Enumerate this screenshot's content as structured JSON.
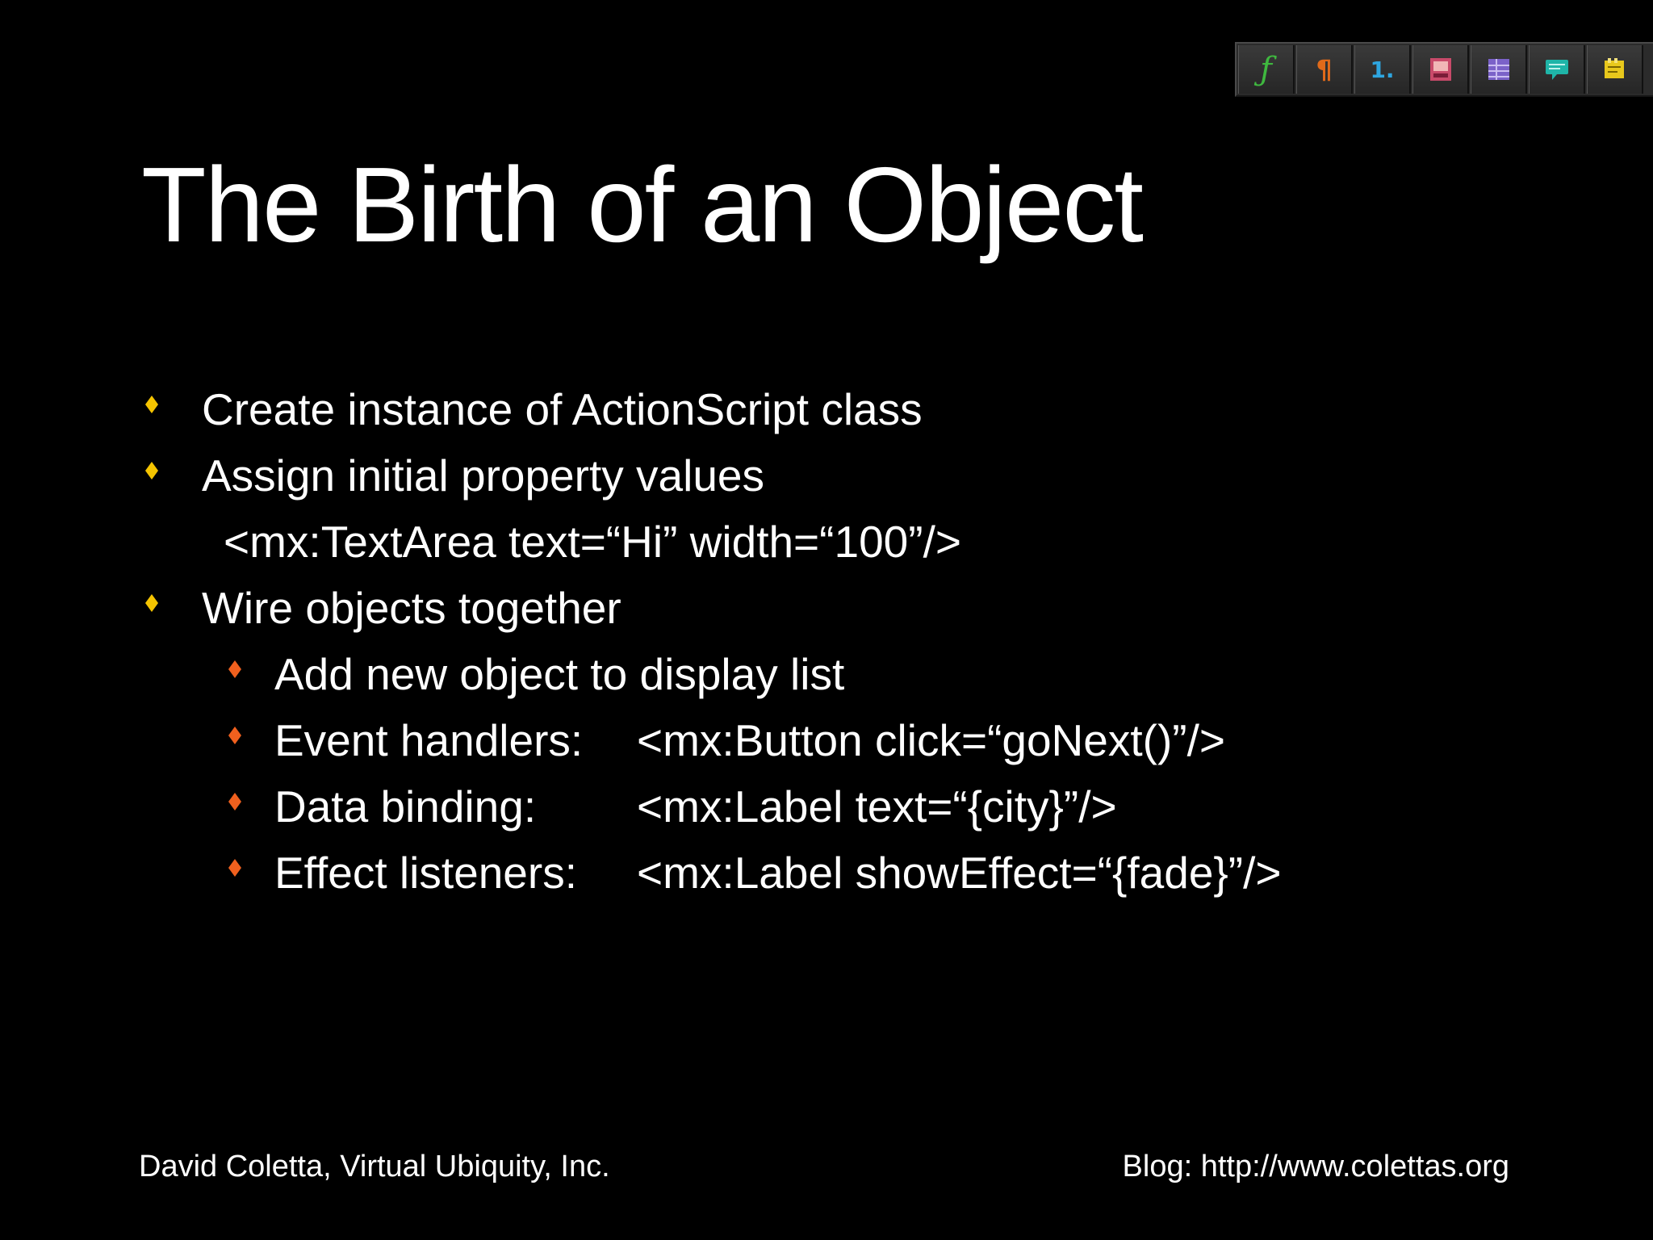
{
  "toolbar": {
    "buttons": [
      {
        "icon": "function-icon",
        "glyph": "ƒ"
      },
      {
        "icon": "paragraph-icon",
        "glyph": "¶"
      },
      {
        "icon": "numbering-icon",
        "glyph": "1."
      },
      {
        "icon": "slide-picture-icon"
      },
      {
        "icon": "table-icon"
      },
      {
        "icon": "comment-icon"
      },
      {
        "icon": "notes-icon"
      }
    ]
  },
  "slide": {
    "title": "The Birth of an Object",
    "bullets": [
      {
        "text": "Create instance of ActionScript class"
      },
      {
        "text": "Assign initial property values"
      },
      {
        "code": "<mx:TextArea text=“Hi” width=“100”/>"
      },
      {
        "text": "Wire objects together"
      }
    ],
    "sub_bullets": [
      {
        "text": "Add new object to display list",
        "code": ""
      },
      {
        "text": "Event handlers:",
        "code": "<mx:Button click=“goNext()”/>"
      },
      {
        "text": "Data binding:",
        "code": "<mx:Label text=“{city}”/>"
      },
      {
        "text": "Effect listeners:",
        "code": "<mx:Label showEffect=“{fade}”/>"
      }
    ],
    "footer_left": "David Coletta, Virtual Ubiquity, Inc.",
    "footer_right": "Blog: http://www.colettas.org"
  },
  "colors": {
    "background": "#000000",
    "text": "#ffffff",
    "bullet_level1": "#f5c400",
    "bullet_level2": "#f0601e"
  }
}
